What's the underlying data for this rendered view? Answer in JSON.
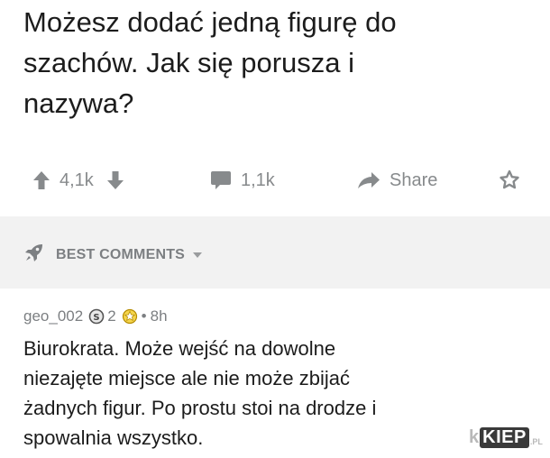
{
  "post": {
    "title_lines": [
      "Możesz dodać jedną figurę do",
      "szachów. Jak się porusza i",
      "nazywa?"
    ]
  },
  "actions": {
    "upvote_icon": "arrow-up-icon",
    "votes": "4,1k",
    "downvote_icon": "arrow-down-icon",
    "comments_icon": "speech-bubble-icon",
    "comments": "1,1k",
    "share_icon": "share-arrow-icon",
    "share": "Share",
    "award_icon": "award-icon"
  },
  "sort": {
    "icon": "rocket-icon",
    "label": "BEST COMMENTS",
    "chevron": "caret-down-icon"
  },
  "comment": {
    "author": "geo_002",
    "badge1_icon": "coin-icon",
    "badge1_count": "2",
    "badge2_icon": "award-icon",
    "separator": "•",
    "time": "8h",
    "body_lines": [
      "Biurokrata. Może wejść na dowolne",
      "niezajęte miejsce ale nie może zbijać",
      "żadnych figur. Po prostu stoi na drodze i",
      "spowalnia wszystko."
    ]
  },
  "watermark": {
    "pre": "k",
    "box": "KIEP",
    "tld": ".PL"
  },
  "colors": {
    "muted": "#878a8c",
    "text": "#1c1c1c",
    "band": "#f2f2f2"
  }
}
